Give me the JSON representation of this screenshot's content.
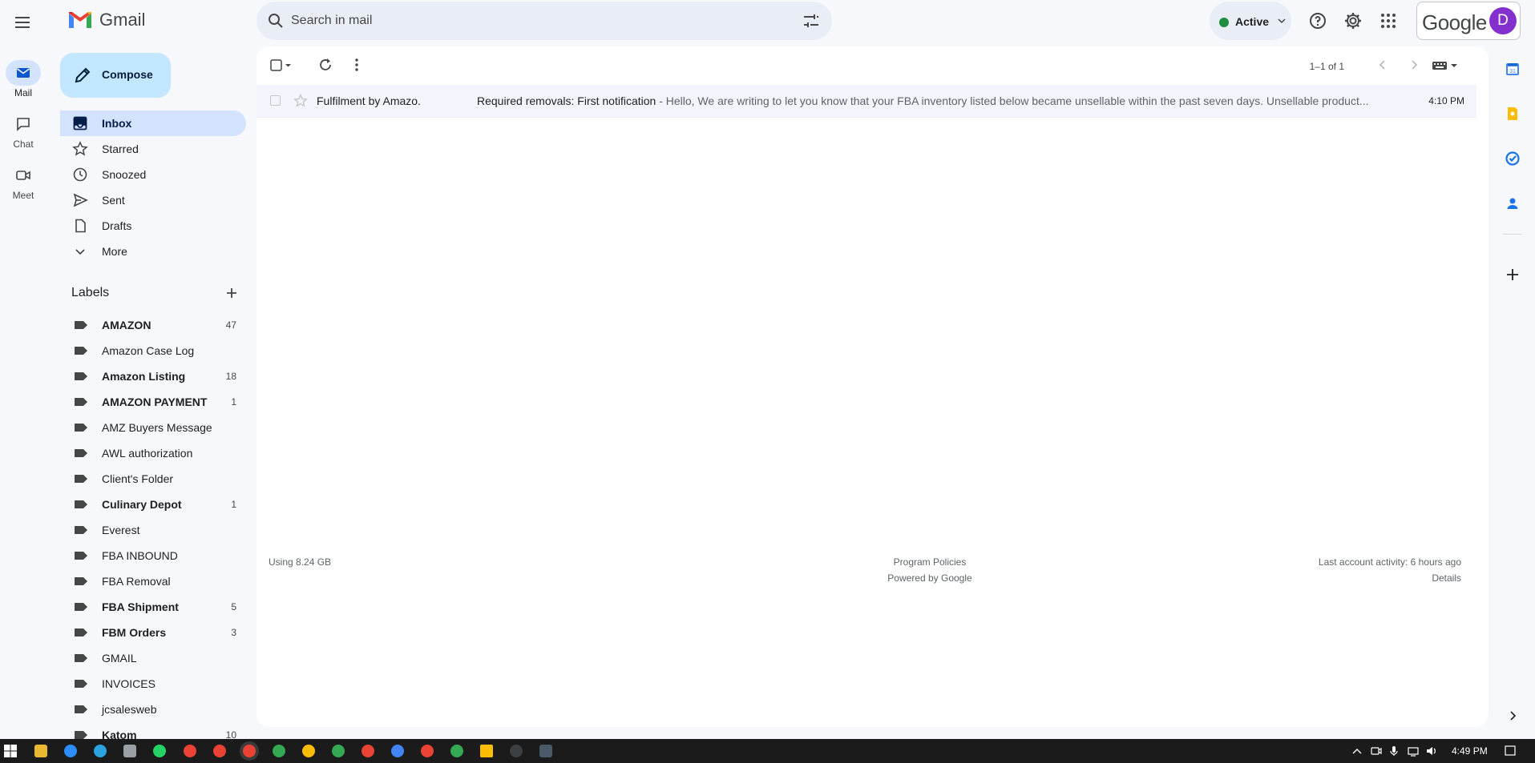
{
  "app": {
    "name": "Gmail"
  },
  "search": {
    "placeholder": "Search in mail"
  },
  "status": {
    "label": "Active",
    "color": "#1e8e3e"
  },
  "account": {
    "brand": "Google",
    "avatar_letter": "D"
  },
  "rail": [
    {
      "label": "Mail",
      "icon": "mail-icon"
    },
    {
      "label": "Chat",
      "icon": "chat-icon"
    },
    {
      "label": "Meet",
      "icon": "meet-icon"
    }
  ],
  "compose": {
    "label": "Compose"
  },
  "nav": [
    {
      "label": "Inbox",
      "icon": "inbox-icon",
      "selected": true
    },
    {
      "label": "Starred",
      "icon": "star-icon"
    },
    {
      "label": "Snoozed",
      "icon": "clock-icon"
    },
    {
      "label": "Sent",
      "icon": "send-icon"
    },
    {
      "label": "Drafts",
      "icon": "draft-icon"
    },
    {
      "label": "More",
      "icon": "chevron-down-icon"
    }
  ],
  "labels": {
    "title": "Labels",
    "items": [
      {
        "name": "AMAZON",
        "count": "47",
        "bold": true
      },
      {
        "name": "Amazon Case Log",
        "count": "",
        "bold": false
      },
      {
        "name": "Amazon Listing",
        "count": "18",
        "bold": true
      },
      {
        "name": "AMAZON PAYMENT",
        "count": "1",
        "bold": true
      },
      {
        "name": "AMZ Buyers Message",
        "count": "",
        "bold": false
      },
      {
        "name": "AWL authorization",
        "count": "",
        "bold": false
      },
      {
        "name": "Client's Folder",
        "count": "",
        "bold": false
      },
      {
        "name": "Culinary Depot",
        "count": "1",
        "bold": true
      },
      {
        "name": "Everest",
        "count": "",
        "bold": false
      },
      {
        "name": "FBA INBOUND",
        "count": "",
        "bold": false
      },
      {
        "name": "FBA Removal",
        "count": "",
        "bold": false
      },
      {
        "name": "FBA Shipment",
        "count": "5",
        "bold": true
      },
      {
        "name": "FBM Orders",
        "count": "3",
        "bold": true
      },
      {
        "name": "GMAIL",
        "count": "",
        "bold": false
      },
      {
        "name": "INVOICES",
        "count": "",
        "bold": false
      },
      {
        "name": "jcsalesweb",
        "count": "",
        "bold": false
      },
      {
        "name": "Katom",
        "count": "10",
        "bold": true
      }
    ]
  },
  "toolbar": {
    "pager": "1–1 of 1"
  },
  "emails": [
    {
      "sender": "Fulfilment by Amazo.",
      "subject": "Required removals: First notification",
      "snippet": " - Hello, We are writing to let you know that your FBA inventory listed below became unsellable within the past seven days. Unsellable product...",
      "time": "4:10 PM"
    }
  ],
  "footer": {
    "storage": "Using 8.24 GB",
    "policies": "Program Policies",
    "powered": "Powered by Google",
    "activity": "Last account activity: 6 hours ago",
    "details": "Details"
  },
  "taskbar": {
    "time": "4:49 PM"
  }
}
